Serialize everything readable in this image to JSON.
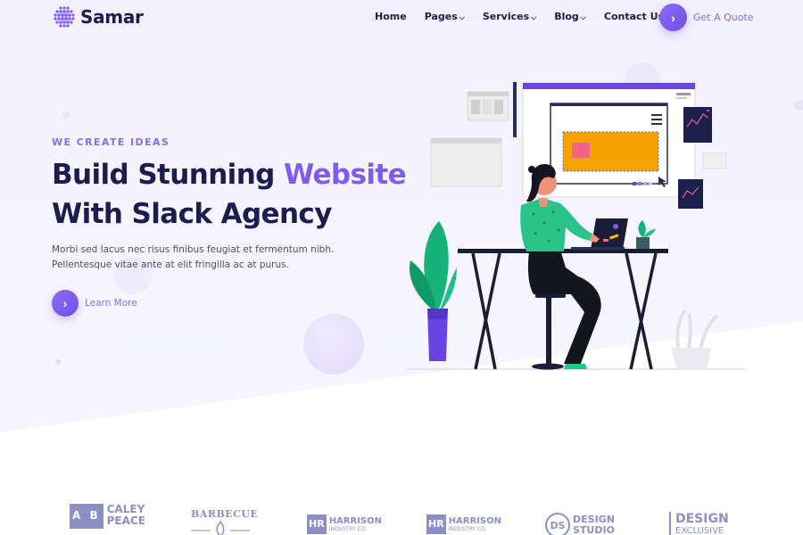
{
  "brand": {
    "name": "Samar",
    "accent": "#7f5cf0",
    "text_color": "#1b1d4e"
  },
  "nav": {
    "items": [
      {
        "label": "Home",
        "dropdown": false
      },
      {
        "label": "Pages",
        "dropdown": true
      },
      {
        "label": "Services",
        "dropdown": true
      },
      {
        "label": "Blog",
        "dropdown": true
      },
      {
        "label": "Contact Us",
        "dropdown": false
      }
    ],
    "cta_label": "Get A Quote",
    "cta_icon": "chevron-right-icon"
  },
  "hero": {
    "kicker": "WE CREATE IDEAS",
    "headline_part1": "Build Stunning ",
    "headline_accent": "Website",
    "headline_part2": "With Slack Agency",
    "lead": "Morbi sed lacus nec risus finibus feugiat et fermentum nibh. Pellentesque vitae ante at elit fringilla ac at purus.",
    "button_label": "Learn More",
    "button_icon": "chevron-right-icon"
  },
  "brands": [
    {
      "name": "caley-peace",
      "badge": "A B",
      "line1": "CALEY",
      "line2": "PEACE"
    },
    {
      "name": "barbecue",
      "line1": "BARBECUE"
    },
    {
      "name": "harrison-1",
      "badge": "HR",
      "line1": "HARRISON",
      "line2": "INDUSTRY CO."
    },
    {
      "name": "harrison-2",
      "badge": "HR",
      "line1": "HARRISON",
      "line2": "INDUSTRY CO."
    },
    {
      "name": "design-studio",
      "badge": "DS",
      "line1": "DESIGN",
      "line2": "STUDIO"
    },
    {
      "name": "design-exclusive",
      "line1": "DESIGN",
      "line2": "EXCLUSIVE"
    }
  ]
}
